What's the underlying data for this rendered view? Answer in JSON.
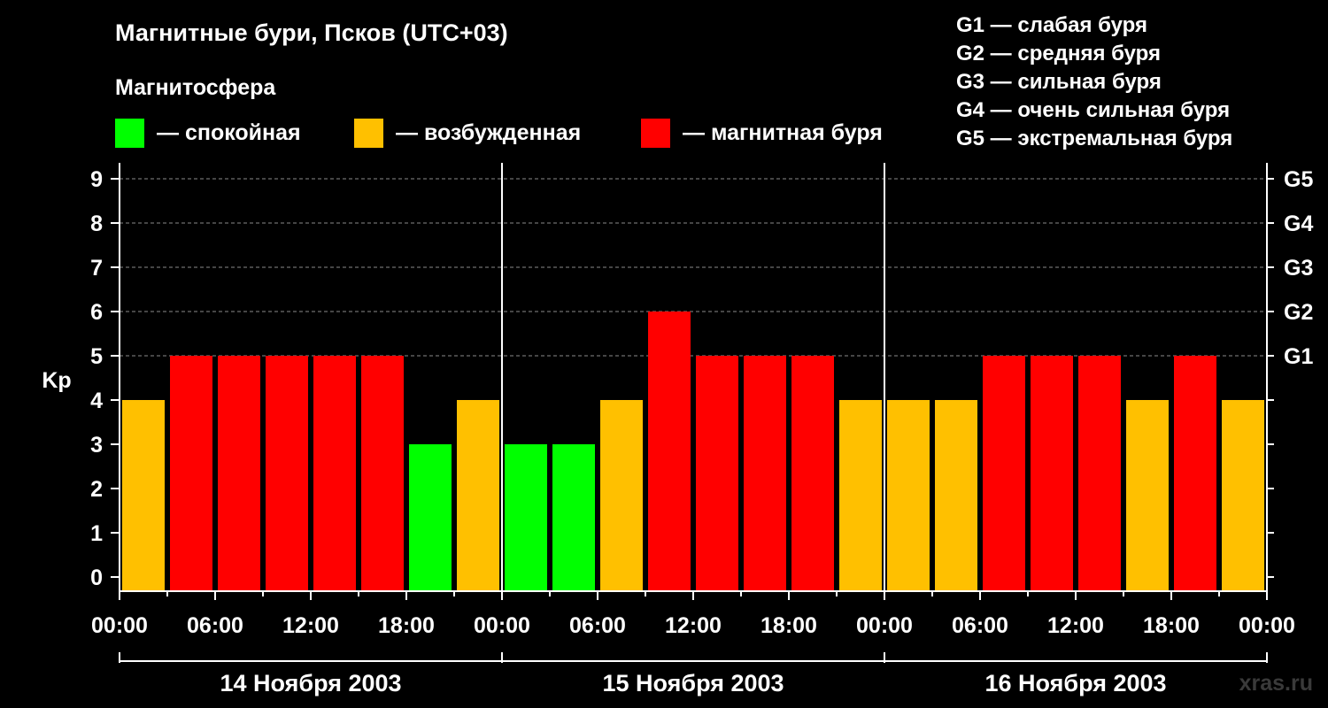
{
  "title": "Магнитные бури, Псков (UTC+03)",
  "magnetosphere_label": "Магнитосфера",
  "legend": [
    {
      "label": "— спокойная",
      "color": "#00ff00"
    },
    {
      "label": "— возбужденная",
      "color": "#ffc000"
    },
    {
      "label": "— магнитная буря",
      "color": "#ff0000"
    }
  ],
  "g_levels": [
    "G1 — слабая буря",
    "G2 — средняя буря",
    "G3 — сильная буря",
    "G4 — очень сильная буря",
    "G5 — экстремальная буря"
  ],
  "watermark": "xras.ru",
  "chart_data": {
    "type": "bar",
    "ylabel": "Kp",
    "ylim": [
      0,
      9
    ],
    "yticks": [
      "0",
      "1",
      "2",
      "3",
      "4",
      "5",
      "6",
      "7",
      "8",
      "9"
    ],
    "right_ticks": [
      {
        "value": 5,
        "label": "G1"
      },
      {
        "value": 6,
        "label": "G2"
      },
      {
        "value": 7,
        "label": "G3"
      },
      {
        "value": 8,
        "label": "G4"
      },
      {
        "value": 9,
        "label": "G5"
      }
    ],
    "grid": "dashed horizontal lines at Kp 5 to 9",
    "xtick_labels": [
      "00:00",
      "06:00",
      "12:00",
      "18:00",
      "00:00",
      "06:00",
      "12:00",
      "18:00",
      "00:00",
      "06:00",
      "12:00",
      "18:00",
      "00:00"
    ],
    "days": [
      "14 Ноября 2003",
      "15 Ноября 2003",
      "16 Ноября 2003"
    ],
    "interval_hours": 3,
    "values": [
      4,
      5,
      5,
      5,
      5,
      5,
      3,
      4,
      3,
      3,
      4,
      6,
      5,
      5,
      5,
      4,
      4,
      4,
      5,
      5,
      5,
      4,
      5,
      4
    ],
    "colors": {
      "quiet": "#00ff00",
      "active": "#ffc000",
      "storm": "#ff0000"
    }
  }
}
